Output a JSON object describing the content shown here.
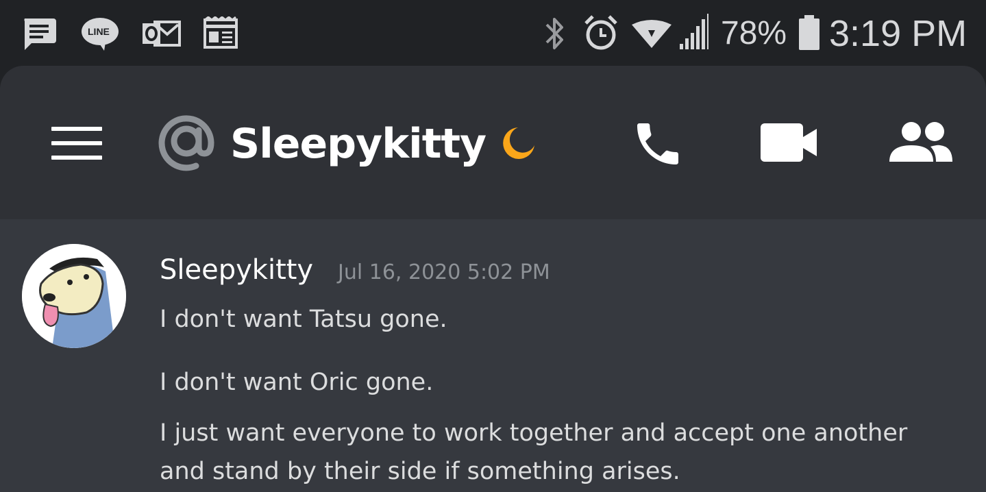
{
  "status_bar": {
    "notification_icons": [
      "message-icon",
      "line-app-icon",
      "outlook-icon",
      "news-icon"
    ],
    "system_icons": [
      "bluetooth-icon",
      "alarm-icon",
      "wifi-icon",
      "signal-icon",
      "battery-icon"
    ],
    "line_badge": "LINE",
    "battery_percent": "78%",
    "time": "3:19 PM"
  },
  "header": {
    "menu_icon": "hamburger-menu-icon",
    "dm_icon": "at-icon",
    "channel_name": "Sleepykitty",
    "status": "idle",
    "status_color": "#faa61a",
    "actions": [
      "voice-call-icon",
      "video-call-icon",
      "members-icon"
    ]
  },
  "message": {
    "author": "Sleepykitty",
    "timestamp": "Jul 16, 2020 5:02 PM",
    "lines": [
      "I don't want Tatsu gone.",
      "I don't want Oric gone.",
      "I just want everyone to work together and accept one another",
      "and stand by their side if something arises."
    ]
  },
  "colors": {
    "status_bar_bg": "#202225",
    "header_bg": "#2f3136",
    "chat_bg": "#36393f",
    "text_primary": "#ffffff",
    "text_message": "#dcddde",
    "text_muted": "#8e9297"
  }
}
